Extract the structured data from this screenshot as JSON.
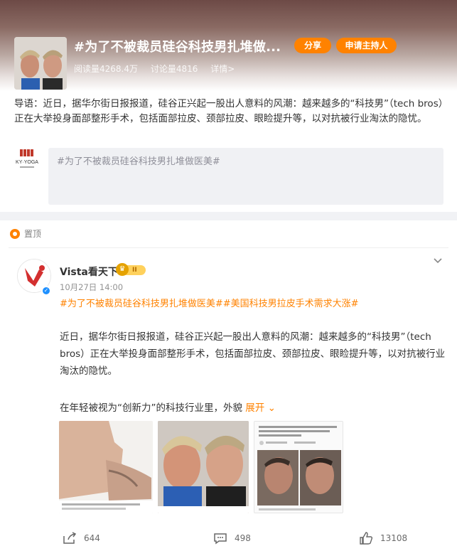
{
  "topic": {
    "title": "#为了不被裁员硅谷科技男扎堆做...",
    "share_label": "分享",
    "host_label": "申请主持人",
    "reads": "阅读量4268.4万",
    "discussions": "讨论量4816",
    "details": "详情>",
    "intro": "导语：近日，据华尔街日报报道，硅谷正兴起一股出人意料的风潮：越来越多的“科技男”（tech bros）正在大举投身面部整形手术，包括面部拉皮、颈部拉皮、眼睑提升等，以对抗被行业淘汰的隐忧。",
    "editor_placeholder": "#为了不被裁员硅谷科技男扎堆做医美#",
    "logo_text": "KY·YOGA"
  },
  "post": {
    "pinned_label": "置顶",
    "author": "Vista看天下",
    "badge": "II",
    "time": "10月27日 14:00",
    "tags": "#为了不被裁员硅谷科技男扎堆做医美##美国科技男拉皮手术需求大涨#",
    "body": "近日，据华尔街日报报道，硅谷正兴起一股出人意料的风潮：越来越多的“科技男”（tech bros）正在大举投身面部整形手术，包括面部拉皮、颈部拉皮、眼睑提升等，以对抗被行业淘汰的隐忧。",
    "body2": "在年轻被视为“创新力”的科技行业里，外貌",
    "expand_label": "展开",
    "shares": "644",
    "comments": "498",
    "likes": "13108"
  },
  "colors": {
    "accent": "#ff8200",
    "verified": "#1e90ff"
  },
  "icons": [
    "share-icon",
    "comment-icon",
    "like-icon",
    "chevron-down-icon",
    "pin-icon",
    "verified-icon"
  ]
}
